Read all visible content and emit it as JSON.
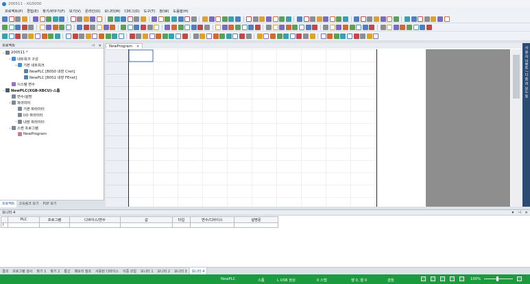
{
  "window": {
    "title": "200511 - XG5000"
  },
  "menu": [
    "프로젝트(P)",
    "편집(E)",
    "찾기/바꾸기(F)",
    "보기(V)",
    "온라인(O)",
    "모니터(M)",
    "디버그(D)",
    "도구(T)",
    "창(W)",
    "도움말(H)"
  ],
  "project_panel": {
    "title": "프로젝트",
    "tree": [
      {
        "label": "200511 *",
        "toggle": "⌄",
        "indent": 0,
        "color": "#6d7886",
        "bold": false
      },
      {
        "label": "네트워크 구성",
        "toggle": "⌄",
        "indent": 1,
        "color": "#3e8fd6",
        "bold": false
      },
      {
        "label": "기본 네트워크",
        "toggle": "⌄",
        "indent": 2,
        "color": "#3e8fd6",
        "bold": false
      },
      {
        "label": "NewPLC [B0S0 내장 Cnet]",
        "toggle": "",
        "indent": 3,
        "color": "#5a7fa8",
        "bold": false
      },
      {
        "label": "NewPLC [B0S1 내장 FEnet]",
        "toggle": "",
        "indent": 3,
        "color": "#5a7fa8",
        "bold": false
      },
      {
        "label": "시스템 변수",
        "toggle": "",
        "indent": 1,
        "color": "#9b6fc0",
        "bold": false
      },
      {
        "label": "NewPLC(XGB-XBCU)-스톱",
        "toggle": "⌄",
        "indent": 0,
        "color": "#4d5b6b",
        "bold": true
      },
      {
        "label": "변수/설명",
        "toggle": "",
        "indent": 1,
        "color": "#7a8796",
        "bold": false
      },
      {
        "label": "파라미터",
        "toggle": "⌄",
        "indent": 1,
        "color": "#7a8796",
        "bold": false
      },
      {
        "label": "기본 파라미터",
        "toggle": "",
        "indent": 2,
        "color": "#7a8796",
        "bold": false
      },
      {
        "label": "I/O 파라미터",
        "toggle": "",
        "indent": 2,
        "color": "#7a8796",
        "bold": false
      },
      {
        "label": "내장 파라미터",
        "toggle": "›",
        "indent": 2,
        "color": "#7a8796",
        "bold": false
      },
      {
        "label": "스캔 프로그램",
        "toggle": "⌄",
        "indent": 1,
        "color": "#7a8796",
        "bold": false
      },
      {
        "label": "NewProgram",
        "toggle": "",
        "indent": 2,
        "color": "#c77f8f",
        "bold": false
      }
    ],
    "tabs": [
      "프로젝트",
      "고속링크 보기",
      "P2P 보기"
    ]
  },
  "document": {
    "tab": "NewProgram",
    "close": "×"
  },
  "right_strip": {
    "label": "사 용 자 이벤트 / 다 중 리 보드 등"
  },
  "monitor": {
    "title": "모니터 4",
    "columns": [
      "PLC",
      "프로그램",
      "디바이스/변수",
      "값",
      "타입",
      "변수/디바이스",
      "설명문"
    ],
    "row_marker": "I"
  },
  "bottom_tabs": [
    "결과",
    "프로그램 검사",
    "찾기 1",
    "찾기 2",
    "통신",
    "메모리 참조",
    "사용된 디바이스",
    "이중 코일",
    "모니터 1",
    "모니터 2",
    "모니터 3",
    "모니터 4"
  ],
  "status": {
    "plc": "NewPLC",
    "mode": "스톱",
    "connection": "L USB 정상",
    "scan": "0 스텝",
    "row_col": "행 0, 열 0",
    "overwrite": "겹침",
    "zoom": "100%"
  },
  "colors": {
    "status_bar": "#1c9a3e",
    "right_strip": "#2b4b73"
  },
  "icons": {
    "panel_pin": "pin-icon",
    "panel_close": "close-icon",
    "toolbar": "toolbar-icons"
  }
}
